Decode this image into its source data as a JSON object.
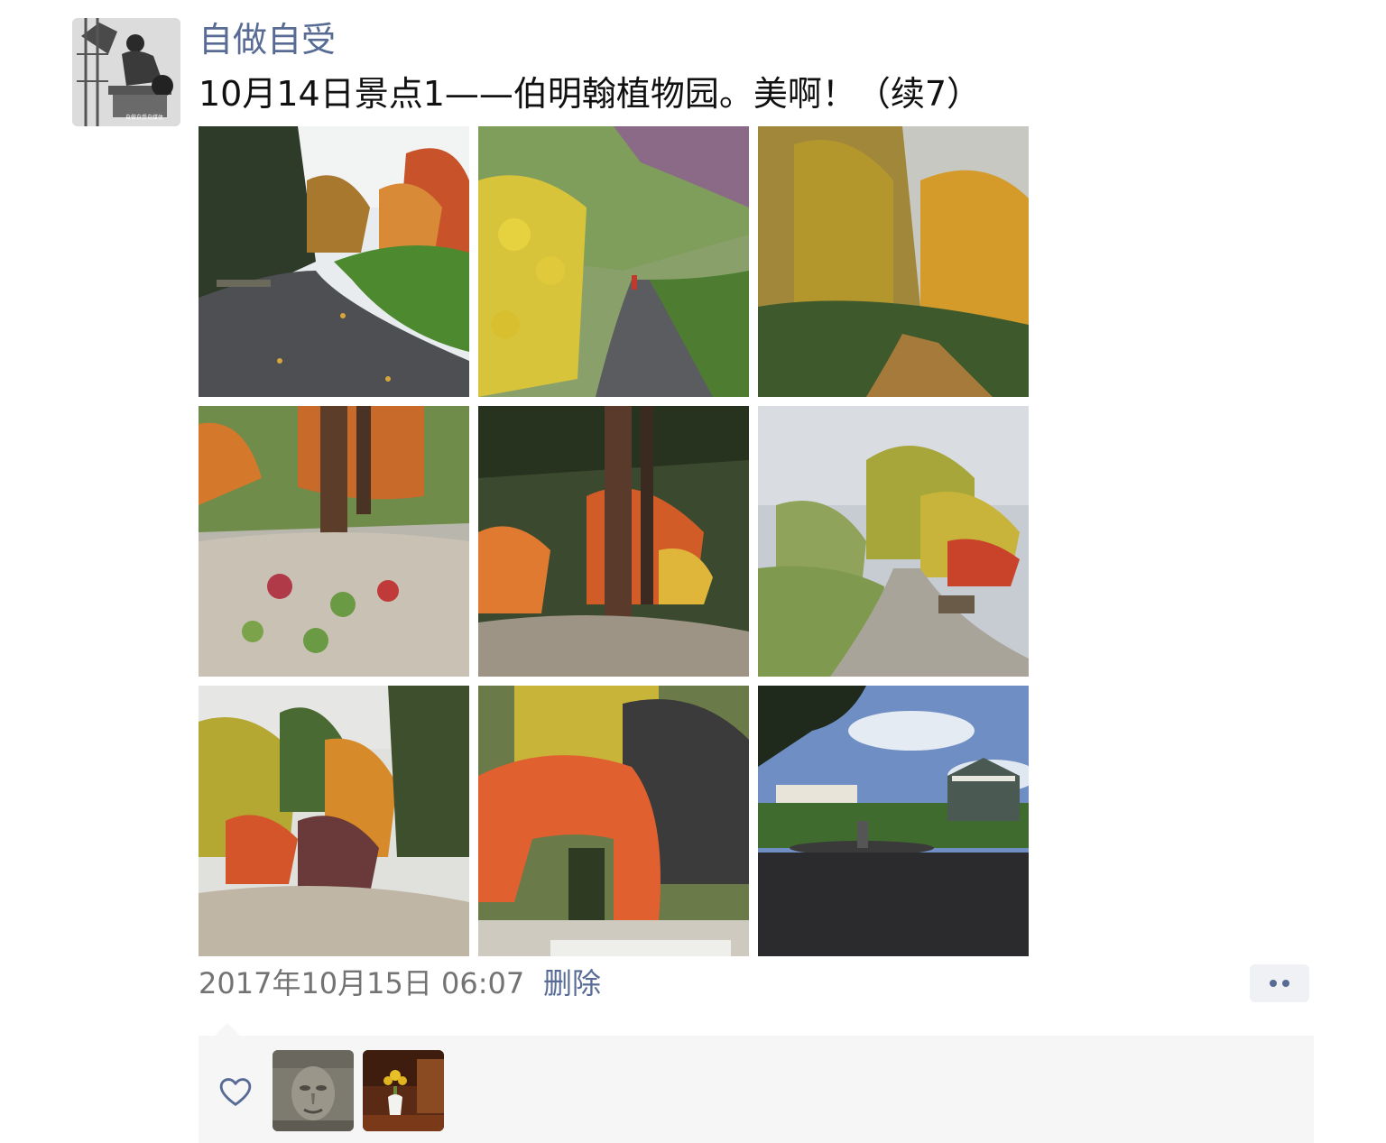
{
  "post": {
    "author": "自做自受",
    "text": "10月14日景点1——伯明翰植物园。美啊！（续7）",
    "timestamp": "2017年10月15日 06:07",
    "delete_label": "删除",
    "avatar_caption": "自做自受自媒体"
  },
  "photos": [
    {
      "name": "photo-path-lawn-autumn-trees"
    },
    {
      "name": "photo-path-yellow-leaves"
    },
    {
      "name": "photo-yellow-trees-path"
    },
    {
      "name": "photo-rock-garden-tree-trunks"
    },
    {
      "name": "photo-orange-maple-trunk"
    },
    {
      "name": "photo-garden-path-bench"
    },
    {
      "name": "photo-rock-garden-shrubs"
    },
    {
      "name": "photo-red-japanese-maple"
    },
    {
      "name": "photo-fountain-bandstand"
    }
  ],
  "likes": {
    "icon": "heart-outline-icon",
    "likers": [
      {
        "name": "liker-avatar-stone-face"
      },
      {
        "name": "liker-avatar-flower-vase"
      }
    ]
  },
  "more_icon": "more-dots-icon",
  "colors": {
    "link": "#576b95",
    "text": "#111111",
    "timestamp": "#737373",
    "panel_bg": "#f6f6f7"
  }
}
